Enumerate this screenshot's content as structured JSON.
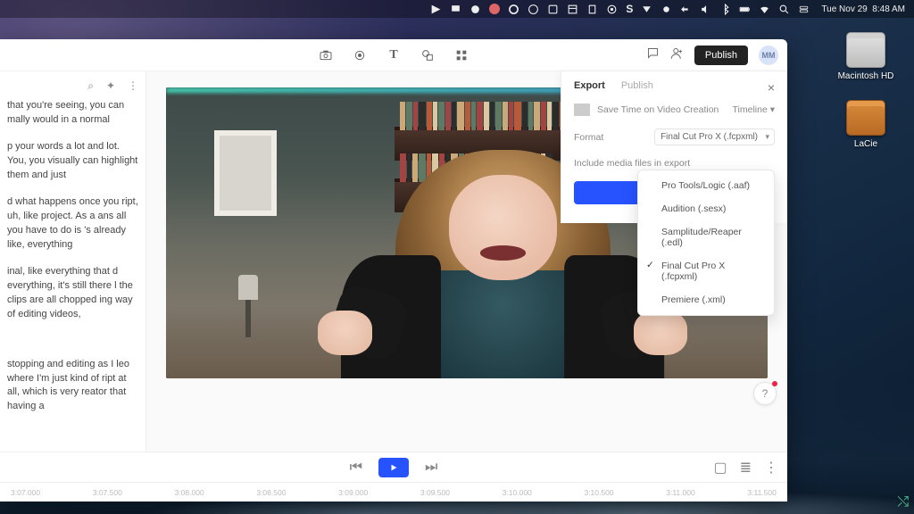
{
  "menubar": {
    "day": "Tue",
    "date": "Nov 29",
    "time": "8:48 AM"
  },
  "desktop_icons": [
    {
      "name": "macintosh-hd",
      "label": "Macintosh HD"
    },
    {
      "name": "lacie",
      "label": "LaCie"
    }
  ],
  "toolbar": {
    "publish_label": "Publish",
    "avatar_initials": "MM"
  },
  "transcript": {
    "p1": "that you're seeing, you can mally would in a normal",
    "p2": "p your words a lot and  lot. You, you visually can  highlight them and just",
    "p3": "d what happens once you ript, uh, like project. As a ans all you have to do is 's already like, everything",
    "p4": "inal, like everything that d everything, it's still there l the clips are all chopped ing way of editing videos,",
    "p5": "stopping and editing as I leo where I'm just kind of ript at all, which is very reator that having a"
  },
  "export": {
    "tab_export": "Export",
    "tab_publish": "Publish",
    "title": "Save Time on Video Creation",
    "scope": "Timeline",
    "format_label": "Format",
    "format_value": "Final Cut Pro X (.fcpxml)",
    "include_label": "Include media files in export",
    "options": [
      "Pro Tools/Logic (.aaf)",
      "Audition (.sesx)",
      "Samplitude/Reaper (.edl)",
      "Final Cut Pro X (.fcpxml)",
      "Premiere (.xml)"
    ],
    "selected_index": 3
  },
  "timeline": {
    "marks": [
      "3:07.000",
      "3:07.500",
      "3:08.000",
      "3:08.500",
      "3:09.000",
      "3:09.500",
      "3:10.000",
      "3:10.500",
      "3:11.000",
      "3:11.500"
    ]
  },
  "shelf_books": {
    "row1": [
      {
        "w": 6,
        "c": "#caa878"
      },
      {
        "w": 7,
        "c": "#5e7a64"
      },
      {
        "w": 5,
        "c": "#a34444"
      },
      {
        "w": 8,
        "c": "#2c2c2c"
      },
      {
        "w": 6,
        "c": "#b65a3a"
      },
      {
        "w": 5,
        "c": "#d8c9a0"
      },
      {
        "w": 7,
        "c": "#5e7a64"
      },
      {
        "w": 6,
        "c": "#a34444"
      },
      {
        "w": 5,
        "c": "#2c2c2c"
      },
      {
        "w": 8,
        "c": "#caa878"
      },
      {
        "w": 6,
        "c": "#b65a3a"
      },
      {
        "w": 5,
        "c": "#5e7a64"
      },
      {
        "w": 7,
        "c": "#a34444"
      },
      {
        "w": 6,
        "c": "#d8c9a0"
      },
      {
        "w": 5,
        "c": "#2c2c2c"
      },
      {
        "w": 7,
        "c": "#5e7a64"
      },
      {
        "w": 6,
        "c": "#caa878"
      },
      {
        "w": 5,
        "c": "#a34444"
      },
      {
        "w": 8,
        "c": "#b65a3a"
      },
      {
        "w": 6,
        "c": "#2c2c2c"
      },
      {
        "w": 5,
        "c": "#5e7a64"
      },
      {
        "w": 7,
        "c": "#caa878"
      },
      {
        "w": 6,
        "c": "#a34444"
      },
      {
        "w": 5,
        "c": "#d8c9a0"
      },
      {
        "w": 7,
        "c": "#2c2c2c"
      },
      {
        "w": 6,
        "c": "#b65a3a"
      }
    ],
    "row2": [
      {
        "w": 7,
        "c": "#a34444"
      },
      {
        "w": 5,
        "c": "#2c2c2c"
      },
      {
        "w": 6,
        "c": "#caa878"
      },
      {
        "w": 8,
        "c": "#5e7a64"
      },
      {
        "w": 5,
        "c": "#b65a3a"
      },
      {
        "w": 7,
        "c": "#d8c9a0"
      },
      {
        "w": 6,
        "c": "#a34444"
      },
      {
        "w": 5,
        "c": "#2c2c2c"
      },
      {
        "w": 8,
        "c": "#caa878"
      },
      {
        "w": 6,
        "c": "#5e7a64"
      },
      {
        "w": 5,
        "c": "#b65a3a"
      },
      {
        "w": 7,
        "c": "#a34444"
      },
      {
        "w": 6,
        "c": "#2c2c2c"
      },
      {
        "w": 5,
        "c": "#d8c9a0"
      },
      {
        "w": 7,
        "c": "#caa878"
      },
      {
        "w": 6,
        "c": "#5e7a64"
      },
      {
        "w": 5,
        "c": "#a34444"
      },
      {
        "w": 8,
        "c": "#b65a3a"
      },
      {
        "w": 6,
        "c": "#2c2c2c"
      },
      {
        "w": 5,
        "c": "#caa878"
      },
      {
        "w": 7,
        "c": "#5e7a64"
      },
      {
        "w": 6,
        "c": "#a34444"
      },
      {
        "w": 5,
        "c": "#d8c9a0"
      },
      {
        "w": 7,
        "c": "#2c2c2c"
      }
    ]
  }
}
